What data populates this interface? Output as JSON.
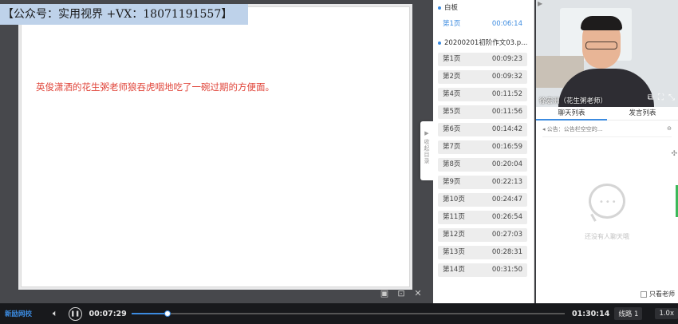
{
  "watermark": "【公众号：实用视界 +VX：18071191557】",
  "slide": {
    "text": "英俊潇洒的花生粥老师狼吞虎咽地吃了一碗过期的方便面。"
  },
  "collapse_tab": "收起目录",
  "chapters": {
    "group1": "白板",
    "group1_items": [
      {
        "label": "第1页",
        "time": "00:06:14"
      }
    ],
    "group2": "20200201初阶作文03.p...",
    "group2_items": [
      {
        "label": "第1页",
        "time": "00:09:23"
      },
      {
        "label": "第2页",
        "time": "00:09:32"
      },
      {
        "label": "第4页",
        "time": "00:11:52"
      },
      {
        "label": "第5页",
        "time": "00:11:56"
      },
      {
        "label": "第6页",
        "time": "00:14:42"
      },
      {
        "label": "第7页",
        "time": "00:16:59"
      },
      {
        "label": "第8页",
        "time": "00:20:04"
      },
      {
        "label": "第9页",
        "time": "00:22:13"
      },
      {
        "label": "第10页",
        "time": "00:24:47"
      },
      {
        "label": "第11页",
        "time": "00:26:54"
      },
      {
        "label": "第12页",
        "time": "00:27:03"
      },
      {
        "label": "第13页",
        "time": "00:28:31"
      },
      {
        "label": "第14页",
        "time": "00:31:50"
      }
    ]
  },
  "video": {
    "name": "徐宏洲（花生粥老师）"
  },
  "chat": {
    "tab_chat": "聊天列表",
    "tab_speak": "发言列表",
    "notice": "公告：公告栏空空的...",
    "empty": "还没有人聊天哦",
    "only_teacher": "只看老师"
  },
  "player": {
    "logo": "新励网校",
    "current_time": "00:07:29",
    "total_time": "01:30:14",
    "progress": 0.083,
    "line": "线路 1",
    "speed": "1.0x"
  }
}
